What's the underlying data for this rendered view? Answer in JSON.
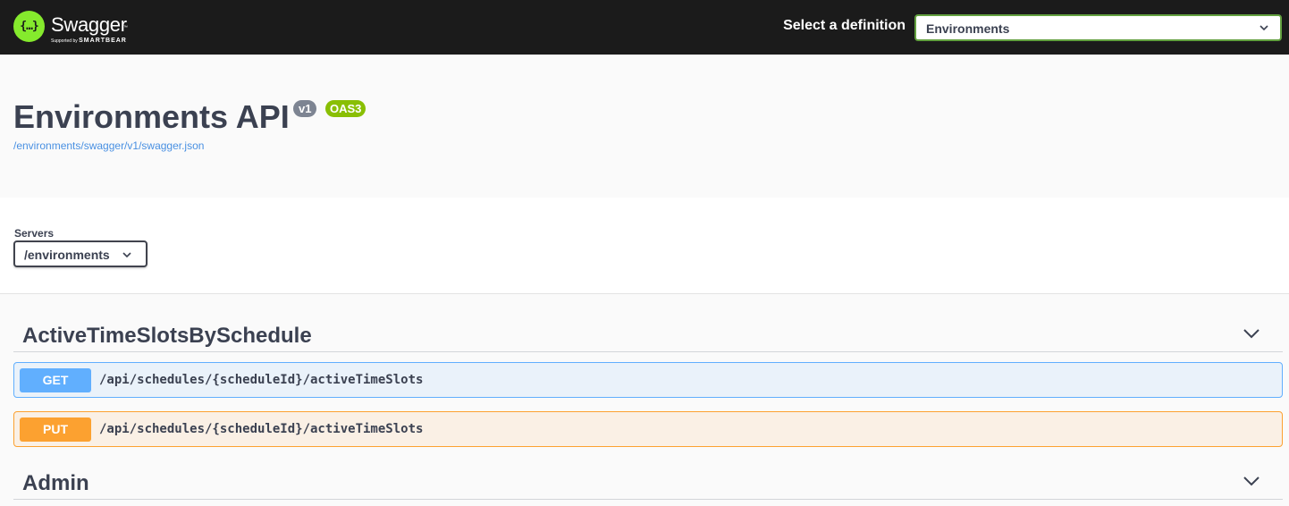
{
  "topbar": {
    "logo": {
      "name": "Swagger",
      "trademark": "™",
      "supported_by": "Supported by",
      "company": "SMARTBEAR",
      "glyph": "{…}",
      "color": "#85ea2d"
    },
    "definition_label": "Select a definition",
    "definition_value": "Environments"
  },
  "info": {
    "title": "Environments API",
    "version_badge": "v1",
    "oas_badge": "OAS3",
    "spec_link": "/environments/swagger/v1/swagger.json"
  },
  "servers": {
    "label": "Servers",
    "selected": "/environments"
  },
  "sections": [
    {
      "name": "ActiveTimeSlotsBySchedule",
      "operations": [
        {
          "method": "GET",
          "path": "/api/schedules/{scheduleId}/activeTimeSlots",
          "color": "#61affe"
        },
        {
          "method": "PUT",
          "path": "/api/schedules/{scheduleId}/activeTimeSlots",
          "color": "#fca130"
        }
      ]
    },
    {
      "name": "Admin",
      "operations": []
    }
  ]
}
